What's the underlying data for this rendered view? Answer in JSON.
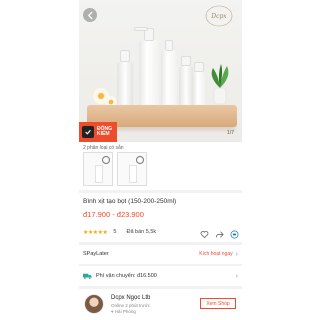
{
  "hero": {
    "logo_text": "Dcpx Ngoc",
    "badge": {
      "line1": "ĐÓNG",
      "line2": "KIỂM"
    },
    "counter": "1/7"
  },
  "variants": {
    "label": "2 phân loại có sẵn"
  },
  "product": {
    "title": "Bình xịt tạo bọt (150-200-250ml)",
    "price": "đ17.900 - đ23.900",
    "rating": "5",
    "sold": "Đã bán 5,5k"
  },
  "rows": {
    "spaylater_label": "SPayLater",
    "spaylater_action": "Kích hoạt ngay",
    "shipping_label": "Phí vận chuyển: đ16.500"
  },
  "shop": {
    "name": "Dcpx Ngọc Ltb",
    "online": "Online 2 phút trước",
    "location": "Hải Phòng",
    "button": "Xem Shop"
  },
  "colors": {
    "accent": "#ee4d2d",
    "star": "#f6a700"
  }
}
